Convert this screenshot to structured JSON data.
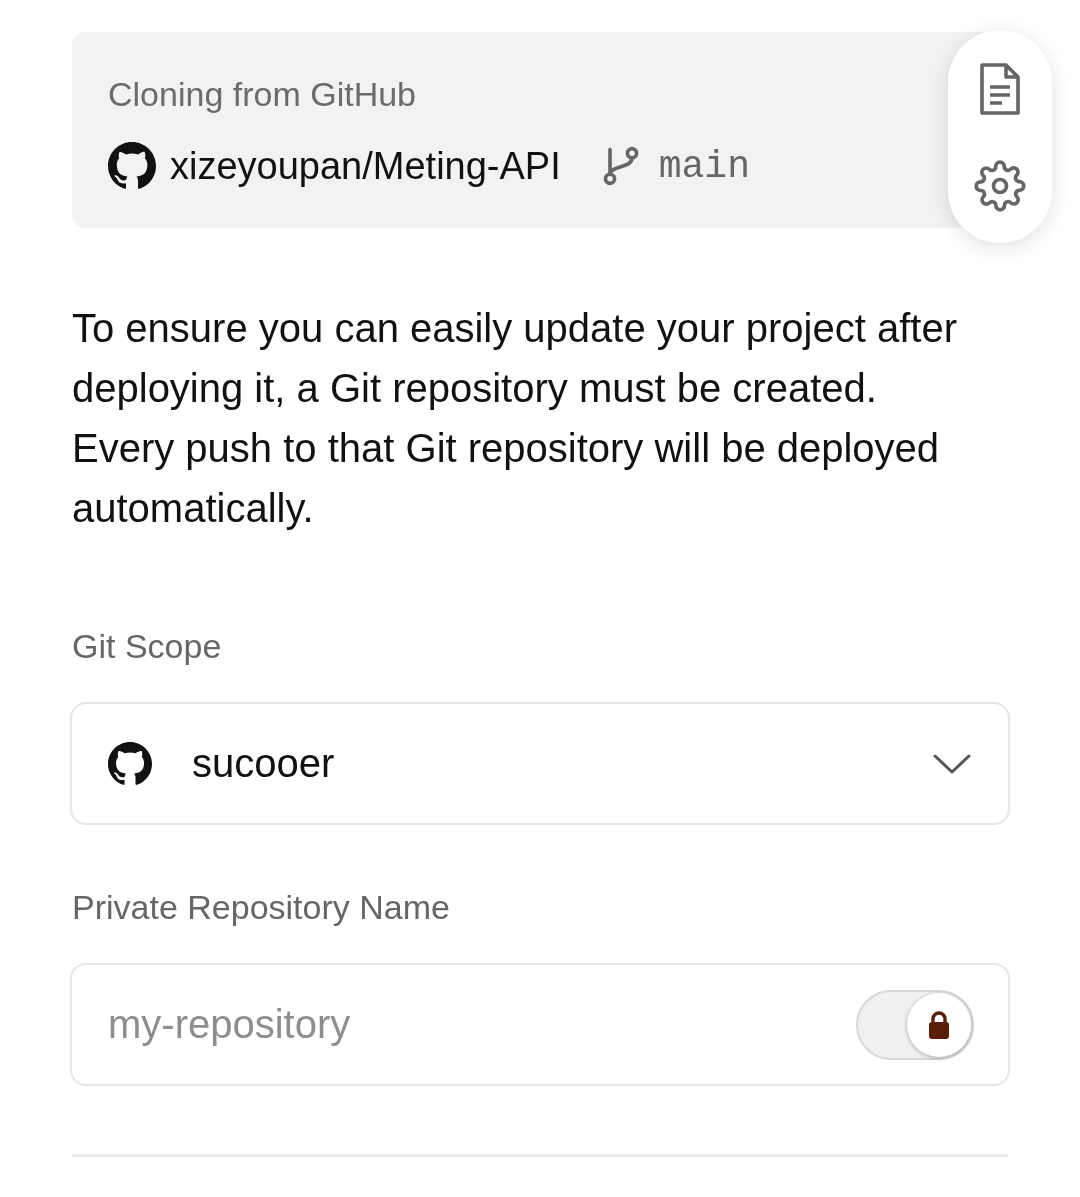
{
  "clone_card": {
    "heading": "Cloning from GitHub",
    "repository": "xizeyoupan/Meting-API",
    "branch": "main"
  },
  "description": "To ensure you can easily update your project after deploying it, a Git repository must be created. Every push to that Git repository will be deployed automatically.",
  "git_scope": {
    "label": "Git Scope",
    "value": "sucooer"
  },
  "repository_name": {
    "label": "Private Repository Name",
    "placeholder": "my-repository",
    "private_toggle": {
      "on": true
    }
  }
}
